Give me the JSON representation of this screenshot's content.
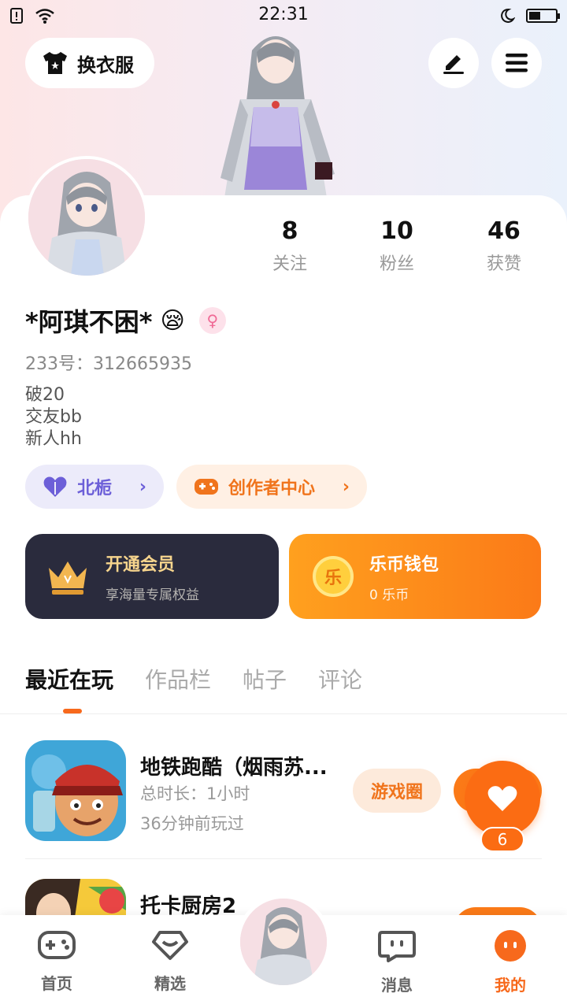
{
  "status_bar": {
    "time": "22:31"
  },
  "header": {
    "dress_label": "换衣服"
  },
  "profile": {
    "name": "*阿琪不困*",
    "emoji": "😪",
    "gender_symbol": "♀",
    "uid": "233号：312665935",
    "bio": [
      "破20",
      "交友bb",
      "新人hh"
    ]
  },
  "stats": [
    {
      "value": "8",
      "label": "关注"
    },
    {
      "value": "10",
      "label": "粉丝"
    },
    {
      "value": "46",
      "label": "获赞"
    }
  ],
  "tags": {
    "guild": "北栀",
    "creator": "创作者中心"
  },
  "vip": {
    "title": "开通会员",
    "subtitle": "享海量专属权益"
  },
  "wallet": {
    "coin_char": "乐",
    "title": "乐币钱包",
    "subtitle": "0 乐币"
  },
  "tabs": [
    "最近在玩",
    "作品栏",
    "帖子",
    "评论"
  ],
  "games": [
    {
      "name": "地铁跑酷（烟雨苏...",
      "duration": "总时长：1小时",
      "last_played": "36分钟前玩过",
      "action": "游戏圈"
    },
    {
      "name": "托卡厨房2"
    }
  ],
  "like": {
    "count": "6"
  },
  "nav": {
    "home": "首页",
    "featured": "精选",
    "messages": "消息",
    "mine": "我的"
  },
  "colors": {
    "accent": "#f7691c",
    "guild": "#6c5fd8",
    "vip_bg": "#2a2b3d",
    "vip_gold": "#f7d58d"
  }
}
